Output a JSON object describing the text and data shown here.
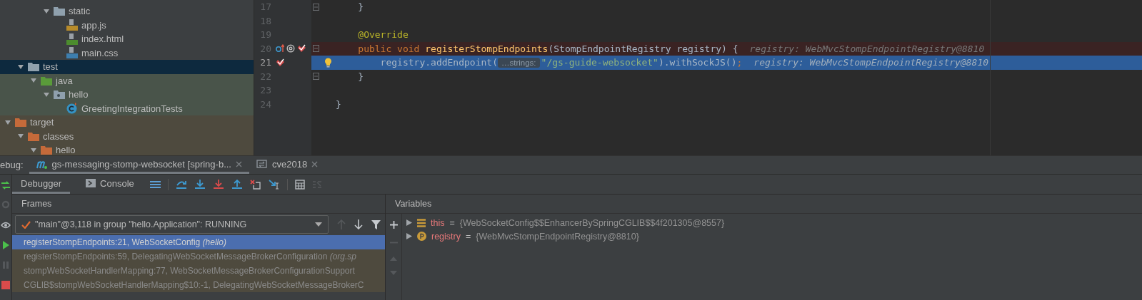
{
  "project_tree": [
    {
      "kind": "resources",
      "items": [
        {
          "kind": "folder",
          "label": "static",
          "expanded": true,
          "selected": false,
          "children": [
            {
              "kind": "js-file",
              "label": "app.js",
              "selected": false
            },
            {
              "kind": "html-file",
              "label": "index.html",
              "selected": false
            },
            {
              "kind": "css-file",
              "label": "main.css",
              "selected": false
            }
          ]
        }
      ]
    },
    {
      "kind": "test",
      "items": [
        {
          "kind": "folder",
          "label": "test",
          "expanded": true,
          "selected": true,
          "children": [
            {
              "kind": "source-folder",
              "label": "java",
              "expanded": true,
              "selected": false,
              "children": [
                {
                  "kind": "package",
                  "label": "hello",
                  "expanded": true,
                  "selected": false,
                  "children": [
                    {
                      "kind": "class",
                      "label": "GreetingIntegrationTests",
                      "selected": false
                    }
                  ]
                }
              ]
            }
          ]
        }
      ]
    },
    {
      "kind": "target",
      "items": [
        {
          "kind": "excluded-folder",
          "label": "target",
          "expanded": true,
          "selected": false,
          "children": [
            {
              "kind": "excluded-folder",
              "label": "classes",
              "expanded": true,
              "selected": false,
              "children": [
                {
                  "kind": "excluded-folder",
                  "label": "hello",
                  "expanded": true,
                  "selected": false
                }
              ]
            }
          ]
        }
      ]
    }
  ],
  "editor": {
    "lines": [
      {
        "number": "17",
        "kind": "plain",
        "fold": true,
        "tokens": [
          {
            "kind": "text",
            "text": "    }"
          }
        ]
      },
      {
        "number": "18",
        "kind": "plain"
      },
      {
        "number": "19",
        "kind": "plain",
        "tokens": [
          {
            "kind": "annotation",
            "text": "    @Override"
          }
        ]
      },
      {
        "number": "20",
        "kind": "breakpoint",
        "fold": true,
        "overrides": true,
        "annotated": true,
        "breakpoint": true,
        "tokens": [
          {
            "kind": "keyword",
            "text": "    public void "
          },
          {
            "kind": "method",
            "text": "registerStompEndpoints"
          },
          {
            "kind": "text",
            "text": "(StompEndpointRegistry registry) {"
          },
          {
            "kind": "debug",
            "text": "registry: WebMvcStompEndpointRegistry@8810"
          }
        ]
      },
      {
        "number": "21",
        "kind": "current",
        "bulb": true,
        "breakpoint": true,
        "tokens": [
          {
            "kind": "text",
            "text": "        registry.addEndpoint("
          },
          {
            "kind": "hint",
            "text": "…strings:"
          },
          {
            "kind": "string",
            "text": "\"/gs-guide-websocket\""
          },
          {
            "kind": "text",
            "text": ").withSockJS()"
          },
          {
            "kind": "keyword",
            "text": ";"
          },
          {
            "kind": "debug",
            "text": "registry: WebMvcStompEndpointRegistry@8810"
          }
        ]
      },
      {
        "number": "22",
        "kind": "plain",
        "fold": true,
        "tokens": [
          {
            "kind": "text",
            "text": "    }"
          }
        ]
      },
      {
        "number": "23",
        "kind": "plain"
      },
      {
        "number": "24",
        "kind": "plain",
        "tokens": [
          {
            "kind": "text",
            "text": "}"
          }
        ]
      }
    ]
  },
  "debug": {
    "label": "ebug:",
    "sessions": [
      {
        "kind": "maven",
        "label": "gs-messaging-stomp-websocket [spring-b...",
        "selected": true
      },
      {
        "kind": "config",
        "label": "cve2018",
        "selected": false
      }
    ],
    "tabs": [
      {
        "kind": "debugger",
        "label": "Debugger",
        "selected": true
      },
      {
        "kind": "console",
        "label": "Console",
        "selected": false
      }
    ],
    "frames": {
      "title": "Frames",
      "thread": "\"main\"@3,118 in group \"hello.Application\": RUNNING",
      "items": [
        {
          "text": "registerStompEndpoints:21, WebSocketConfig *(hello)*",
          "selected": true
        },
        {
          "text": "registerStompEndpoints:59, DelegatingWebSocketMessageBrokerConfiguration *(org.sp*",
          "selected": false
        },
        {
          "text": "stompWebSocketHandlerMapping:77, WebSocketMessageBrokerConfigurationSupport",
          "selected": false
        },
        {
          "text": "CGLIB$stompWebSocketHandlerMapping$10:-1, DelegatingWebSocketMessageBrokerC",
          "selected": false
        }
      ]
    },
    "variables": {
      "title": "Variables",
      "items": [
        {
          "kind": "field",
          "name": "this",
          "operator": "=",
          "value": "{WebSocketConfig$$EnhancerBySpringCGLIB$$4f201305@8557}"
        },
        {
          "kind": "param",
          "name": "registry",
          "operator": "=",
          "value": "{WebMvcStompEndpointRegistry@8810}"
        }
      ]
    }
  }
}
